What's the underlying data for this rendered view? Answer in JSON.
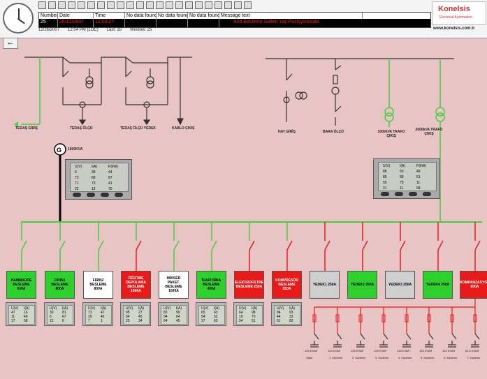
{
  "alarm_table": {
    "headers": [
      "Number",
      "Date",
      "Time",
      "No data found",
      "No data found",
      "No data found",
      "Message text"
    ],
    "row": {
      "number": "25",
      "date": "26/12/2007",
      "time": "12:03:27",
      "message": "Ana Besleme Salteri Yay Pozisyonunda"
    }
  },
  "status": {
    "date": "12/26/2007",
    "time": "12:04 PM (LOC)",
    "last": "Last: 25",
    "window": "Window: 25"
  },
  "logo": {
    "brand": "Konelsis",
    "sub": "Electrical Automation",
    "web": "www.konelsis.com.tr"
  },
  "colors": {
    "bus": "#3fd23f",
    "feeder_red": "#e81b1b",
    "bg": "#e9c4c4",
    "alarm_text": "#ff2020"
  },
  "generator": {
    "symbol": "G",
    "rating": "1500KVA"
  },
  "upper_labels": [
    "TEDAŞ GİRİŞ",
    "TEDAŞ ÖLÇÜ",
    "TEDAŞ ÖLÇÜ YEDEK",
    "KABLO ÇIKIŞ",
    "HAT GİRİŞ",
    "BARA ÖLÇÜ",
    "1000kVA TRAFO ÇIKIŞ",
    "2000kVA TRAFO ÇIKIŞ"
  ],
  "big_meters": [
    {
      "rows": [
        [
          "U(V)",
          "I(A)",
          "P(kW)"
        ],
        [
          "5",
          "38",
          "44"
        ],
        [
          "73",
          "89",
          "87"
        ],
        [
          "71",
          "73",
          "41"
        ],
        [
          "22",
          "12",
          "70"
        ]
      ]
    },
    {
      "rows": [
        [
          "U(V)",
          "I(A)",
          "P(kW)"
        ],
        [
          "88",
          "50",
          "49"
        ],
        [
          "85",
          "89",
          "51"
        ],
        [
          "55",
          "79",
          "11"
        ],
        [
          "21",
          "11",
          "68"
        ]
      ]
    }
  ],
  "feeders": [
    {
      "label": "HAMMADDE BESLEME 630A",
      "color": "green"
    },
    {
      "label": "FIRIN1 BESLEME 800A",
      "color": "green"
    },
    {
      "label": "FIRIN2 BESLEME 800A",
      "color": "white"
    },
    {
      "label": "ÖĞÜTME DEPOLAMA BESLEME 1000A",
      "color": "red"
    },
    {
      "label": "MİKSER PAKET. BESLEME 1000A",
      "color": "white"
    },
    {
      "label": "İDARİ BİNA BESLEME 400A",
      "color": "green"
    },
    {
      "label": "ELEKTROFİLTRE BESLEME 250A",
      "color": "red"
    },
    {
      "label": "KOMPRESÖR BESLEME 250A",
      "color": "red"
    },
    {
      "label": "YEDEK1 250A",
      "color": "grey"
    },
    {
      "label": "YEDEK2 250A",
      "color": "green"
    },
    {
      "label": "YEDEK3 250A",
      "color": "grey"
    },
    {
      "label": "YEDEK4 250A",
      "color": "green"
    },
    {
      "label": "KOMPANZASYON 800A",
      "color": "red"
    }
  ],
  "small_meters": [
    {
      "vals": [
        [
          "U(V)",
          "I(A)"
        ],
        [
          "47",
          "16"
        ],
        [
          "11",
          "40"
        ],
        [
          "17",
          "58"
        ]
      ]
    },
    {
      "vals": [
        [
          "U(V)",
          "I(A)"
        ],
        [
          "30",
          "81"
        ],
        [
          "6",
          "67"
        ],
        [
          "12",
          "6"
        ]
      ]
    },
    {
      "vals": [
        [
          "U(V)",
          "I(A)"
        ],
        [
          "73",
          "47"
        ],
        [
          "29",
          "42"
        ],
        [
          "7",
          "1"
        ]
      ]
    },
    {
      "vals": [
        [
          "U(V)",
          "I(A)"
        ],
        [
          "95",
          "27"
        ],
        [
          "64",
          "45"
        ],
        [
          "25",
          "34"
        ]
      ]
    },
    {
      "vals": [
        [
          "U(V)",
          "I(A)"
        ],
        [
          "82",
          "99"
        ],
        [
          "94",
          "64"
        ],
        [
          "64",
          "45"
        ]
      ]
    },
    {
      "vals": [
        [
          "U(V)",
          "I(A)"
        ],
        [
          "65",
          "63"
        ],
        [
          "54",
          "52"
        ],
        [
          "27",
          "63"
        ]
      ]
    },
    {
      "vals": [
        [
          "U(V)",
          "I(A)"
        ],
        [
          "64",
          "98"
        ],
        [
          "19",
          "70"
        ],
        [
          "54",
          "51"
        ]
      ]
    },
    {
      "vals": [
        [
          "U(V)",
          "I(A)"
        ],
        [
          "84",
          "93"
        ],
        [
          "44",
          "33"
        ],
        [
          "61",
          "82"
        ]
      ]
    }
  ],
  "cap_steps": [
    {
      "kvar": "125 KVAR",
      "name": "Sabit"
    },
    {
      "kvar": "125 KVAR",
      "name": "1. Kademe"
    },
    {
      "kvar": "125 KVAR",
      "name": "2. Kademe"
    },
    {
      "kvar": "125 KVAR",
      "name": "3. Kademe"
    },
    {
      "kvar": "125 KVAR",
      "name": "4. Kademe"
    },
    {
      "kvar": "125 KVAR",
      "name": "5. Kademe"
    },
    {
      "kvar": "125 KVAR",
      "name": "6. Kademe"
    },
    {
      "kvar": "62,5 KVAR",
      "name": "7. Kademe"
    }
  ]
}
